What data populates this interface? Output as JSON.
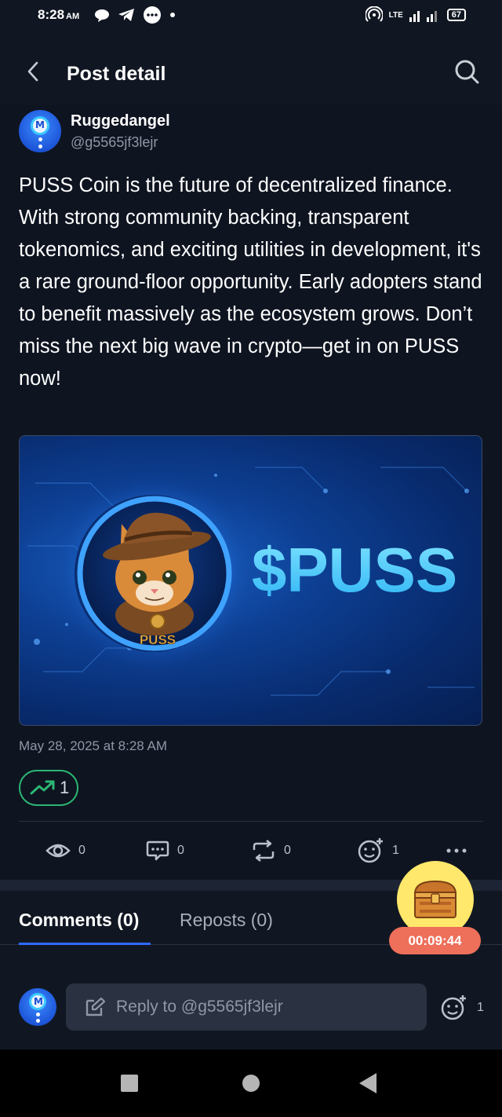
{
  "status_bar": {
    "time": "8:28",
    "ampm": "AM",
    "network": "LTE",
    "battery": "67"
  },
  "header": {
    "title": "Post detail"
  },
  "post": {
    "author_name": "Ruggedangel",
    "author_handle": "@g5565jf3lejr",
    "text": "PUSS Coin is the future of decentralized finance. With strong community backing, transparent tokenomics, and exciting utilities in development, it's a rare ground-floor opportunity. Early adopters stand to benefit massively as the ecosystem grows. Don’t miss the next big wave in crypto—get in on PUSS now!",
    "image": {
      "coin_label": "PUSS",
      "ticker": "$PUSS"
    },
    "date": "May 28, 2025 at 8:28 AM",
    "trend_count": "1"
  },
  "actions": {
    "views": "0",
    "comments": "0",
    "reposts": "0",
    "reactions": "1"
  },
  "tabs": {
    "comments": "Comments (0)",
    "reposts": "Reposts (0)"
  },
  "reward": {
    "timer": "00:09:44"
  },
  "reply": {
    "placeholder": "Reply to @g5565jf3lejr",
    "reactions": "1"
  },
  "colors": {
    "background": "#0e1420",
    "accent_blue": "#2f6bff",
    "trend_green": "#2bb673",
    "timer_red": "#ee6f5a",
    "chest_yellow": "#ffe86b"
  }
}
